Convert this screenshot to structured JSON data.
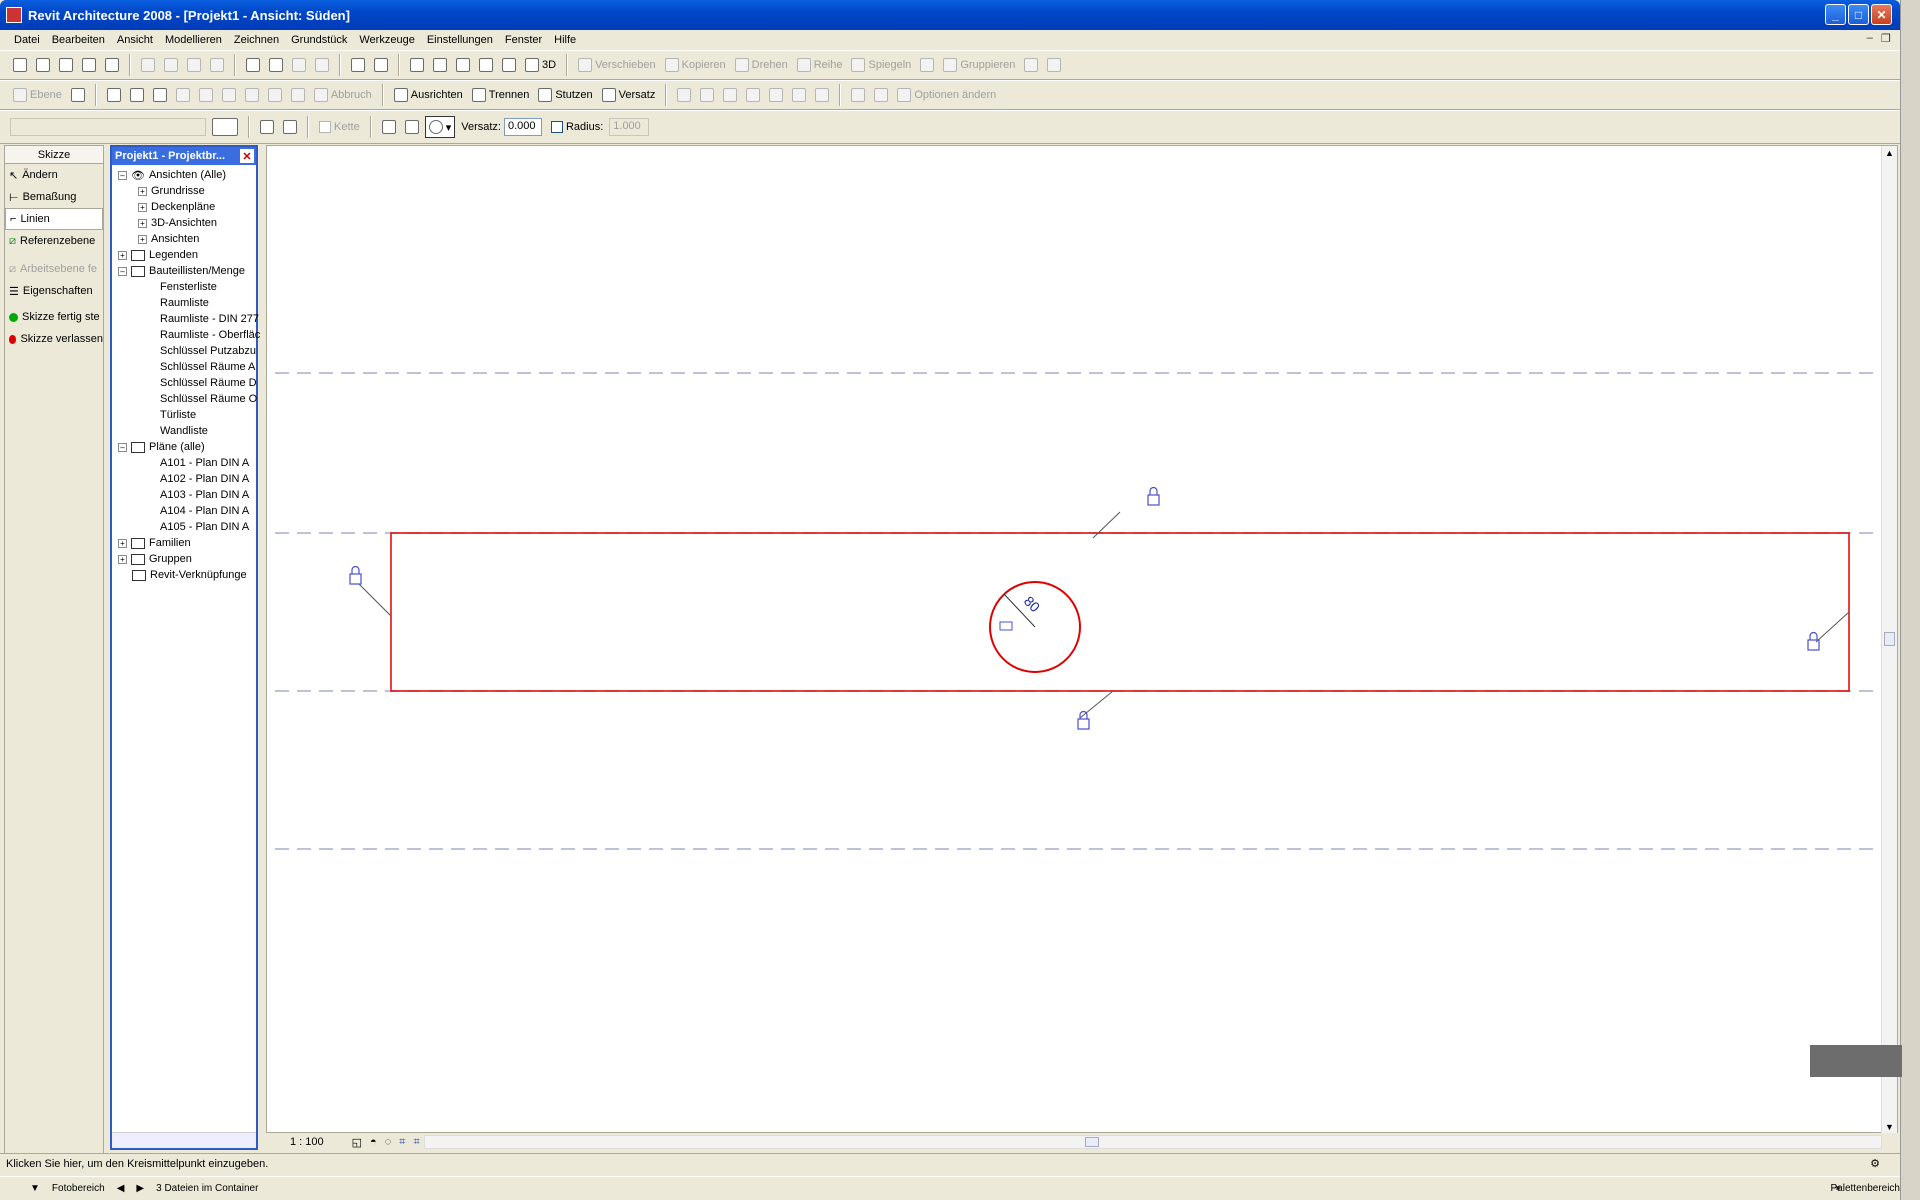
{
  "window": {
    "title": "Revit Architecture 2008 - [Projekt1 - Ansicht: Süden]",
    "buttons": [
      "minimize",
      "maximize",
      "close"
    ]
  },
  "menu": [
    "Datei",
    "Bearbeiten",
    "Ansicht",
    "Modellieren",
    "Zeichnen",
    "Grundstück",
    "Werkzeuge",
    "Einstellungen",
    "Fenster",
    "Hilfe"
  ],
  "toolbar1": {
    "three_d": "3D",
    "verschieben": "Verschieben",
    "kopieren": "Kopieren",
    "drehen": "Drehen",
    "reihe": "Reihe",
    "spiegeln": "Spiegeln",
    "gruppieren": "Gruppieren"
  },
  "toolbar2": {
    "ebene": "Ebene",
    "abbruch": "Abbruch",
    "ausrichten": "Ausrichten",
    "trennen": "Trennen",
    "stutzen": "Stutzen",
    "versatz": "Versatz",
    "optionen": "Optionen ändern"
  },
  "optionsbar": {
    "kette": "Kette",
    "versatz_label": "Versatz:",
    "versatz_value": "0.000",
    "radius_label": "Radius:",
    "radius_value": "1.000"
  },
  "designbar": {
    "header": "Skizze",
    "items": [
      {
        "label": "Ändern",
        "icon": "cursor-icon"
      },
      {
        "label": "Bemaßung",
        "icon": "dimension-icon"
      },
      {
        "label": "Linien",
        "icon": "lines-icon"
      },
      {
        "label": "Referenzebene",
        "icon": "refplane-icon"
      },
      {
        "label": "Arbeitsebene fe",
        "icon": "workplane-icon"
      },
      {
        "label": "Eigenschaften",
        "icon": "properties-icon"
      },
      {
        "label": "Skizze fertig ste",
        "icon": "finish-sketch-icon"
      },
      {
        "label": "Skizze verlassen",
        "icon": "quit-sketch-icon"
      }
    ]
  },
  "project_browser": {
    "title": "Projekt1 - Projektbr...",
    "items": [
      "Ansichten (Alle)",
      "Grundrisse",
      "Deckenpläne",
      "3D-Ansichten",
      "Ansichten",
      "Legenden",
      "Bauteillisten/Menge",
      "Fensterliste",
      "Raumliste",
      "Raumliste - DIN 277",
      "Raumliste - Oberfläc",
      "Schlüssel Putzabzu",
      "Schlüssel Räume A",
      "Schlüssel Räume D",
      "Schlüssel Räume O",
      "Türliste",
      "Wandliste",
      "Pläne (alle)",
      "A101 - Plan DIN A",
      "A102 - Plan DIN A",
      "A103 - Plan DIN A",
      "A104 - Plan DIN A",
      "A105 - Plan DIN A",
      "Familien",
      "Gruppen",
      "Revit-Verknüpfunge"
    ]
  },
  "canvas": {
    "radius_label": "80"
  },
  "view_control": {
    "scale": "1 : 100"
  },
  "status": {
    "text": "Klicken Sie hier, um den Kreismittelpunkt einzugeben."
  },
  "photobar": {
    "left": "Fotobereich",
    "files": "3 Dateien im Container",
    "right": "Palettenbereich"
  },
  "colors": {
    "sketch_red": "#e00000",
    "title_blue": "#0047c7",
    "lock_blue": "#4a50c8"
  }
}
